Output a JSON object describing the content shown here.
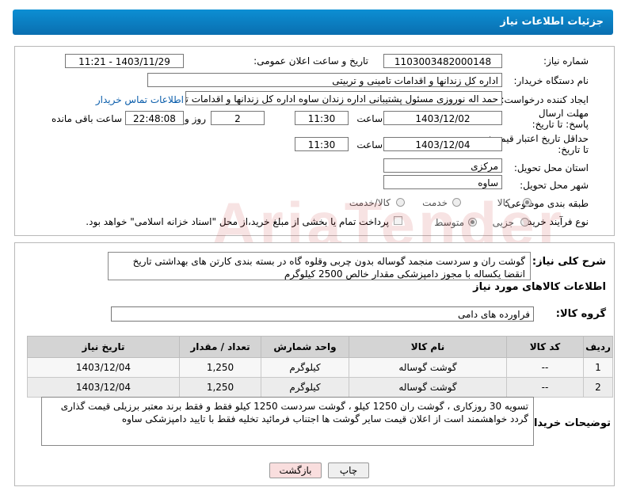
{
  "header": {
    "title": "جزئیات اطلاعات نیاز"
  },
  "fields": {
    "need_number_label": "شماره نیاز:",
    "need_number": "1103003482000148",
    "announce_label": "تاریخ و ساعت اعلان عمومی:",
    "announce_value": "1403/11/29 - 11:21",
    "buyer_org_label": "نام دستگاه خریدار:",
    "buyer_org": "اداره کل زندانها و اقدامات تامینی و تربیتی",
    "requester_label": "ایجاد کننده درخواست:",
    "requester": "حمد اله نوروزی مسئول پشتیبانی اداره زندان ساوه اداره کل زندانها و اقدامات تام",
    "contact_link": "اطلاعات تماس خریدار",
    "deadline_label": "مهلت ارسال پاسخ: تا تاریخ:",
    "deadline_date": "1403/12/02",
    "time_label": "ساعت",
    "deadline_time": "11:30",
    "days_value": "2",
    "days_label": "روز و",
    "remaining_time": "22:48:08",
    "remaining_label": "ساعت باقی مانده",
    "price_valid_label": "حداقل تاریخ اعتبار قیمت: تا تاریخ:",
    "price_valid_date": "1403/12/04",
    "price_valid_time": "11:30",
    "province_label": "استان محل تحویل:",
    "province": "مرکزی",
    "city_label": "شهر محل تحویل:",
    "city": "ساوه",
    "category_label": "طبقه بندی موضوعی:",
    "category_options": [
      "کالا",
      "خدمت",
      "کالا/خدمت"
    ],
    "process_label": "نوع فرآیند خرید :",
    "process_options": [
      "جزیی",
      "متوسط"
    ],
    "payment_note": "پرداخت تمام یا بخشی از مبلغ خرید،از محل \"اسناد خزانه اسلامی\" خواهد بود."
  },
  "description": {
    "label": "شرح کلی نیاز:",
    "text": "گوشت ران و سردست منجمد گوساله بدون چربی وقلوه گاه در بسته بندی کارتن های بهداشتی تاریخ انقضا یکساله با مجوز دامپزشکی مقدار خالص 2500 کیلوگرم"
  },
  "goods": {
    "section_title": "اطلاعات کالاهای مورد نیاز",
    "group_label": "گروه کالا:",
    "group_value": "فراورده های دامی",
    "columns": [
      "ردیف",
      "کد کالا",
      "نام کالا",
      "واحد شمارش",
      "تعداد / مقدار",
      "تاریخ نیاز"
    ],
    "rows": [
      {
        "row": "1",
        "code": "--",
        "name": "گوشت گوساله",
        "unit": "کیلوگرم",
        "qty": "1,250",
        "date": "1403/12/04"
      },
      {
        "row": "2",
        "code": "--",
        "name": "گوشت گوساله",
        "unit": "کیلوگرم",
        "qty": "1,250",
        "date": "1403/12/04"
      }
    ]
  },
  "buyer_notes": {
    "label": "توضیحات خریدار:",
    "text": "تسویه 30 روزکاری ، گوشت ران 1250 کیلو ، گوشت سردست 1250 کیلو فقط و فقط برند معتبر برزیلی قیمت گذاری گردد خواهشمند است از اعلان قیمت سایر گوشت ها اجتناب فرمائید تخلیه فقط با تایید دامپزشکی ساوه"
  },
  "buttons": {
    "print": "چاپ",
    "back": "بازگشت"
  },
  "colors": {
    "title_bar": "#0a7cc1",
    "link": "#0a5dab",
    "back_button_bg": "#f9dede"
  }
}
